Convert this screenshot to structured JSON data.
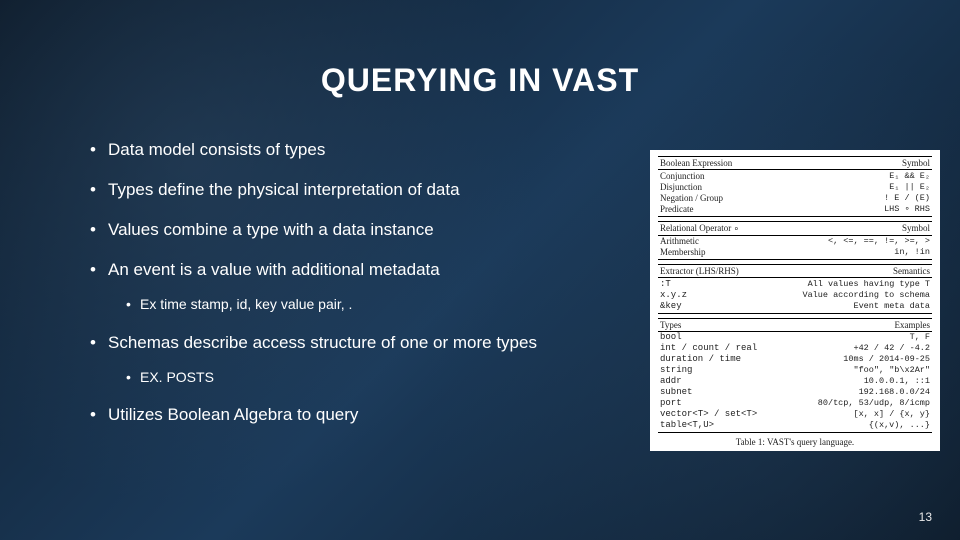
{
  "title": "QUERYING IN VAST",
  "bullets": {
    "b1": "Data model consists of types",
    "b2": "Types define the physical interpretation of data",
    "b3": "Values combine a type with a data instance",
    "b4": "An event is a value with additional metadata",
    "b4s1": "Ex time stamp, id, key value pair, .",
    "b5": "Schemas describe access structure of one or more types",
    "b5s1": "EX. POSTS",
    "b6": "Utilizes Boolean Algebra to query"
  },
  "table": {
    "sec1": {
      "h1": "Boolean Expression",
      "h2": "Symbol",
      "r1a": "Conjunction",
      "r1b": "E₁ && E₂",
      "r2a": "Disjunction",
      "r2b": "E₁ || E₂",
      "r3a": "Negation / Group",
      "r3b": "! E / (E)",
      "r4a": "Predicate",
      "r4b": "LHS ∘ RHS"
    },
    "sec2": {
      "h1": "Relational Operator ∘",
      "h2": "Symbol",
      "r1a": "Arithmetic",
      "r1b": "<, <=, ==, !=, >=, >",
      "r2a": "Membership",
      "r2b": "in, !in"
    },
    "sec3": {
      "h1": "Extractor (LHS/RHS)",
      "h2": "Semantics",
      "r1a": ":T",
      "r1b": "All values having type T",
      "r2a": "x.y.z",
      "r2b": "Value according to schema",
      "r3a": "&key",
      "r3b": "Event meta data"
    },
    "sec4": {
      "h1": "Types",
      "h2": "Examples",
      "r1a": "bool",
      "r1b": "T, F",
      "r2a": "int / count / real",
      "r2b": "+42 / 42 / -4.2",
      "r3a": "duration / time",
      "r3b": "10ms / 2014-09-25",
      "r4a": "string",
      "r4b": "\"foo\", \"b\\x2Ar\"",
      "r5a": "addr",
      "r5b": "10.0.0.1, ::1",
      "r6a": "subnet",
      "r6b": "192.168.0.0/24",
      "r7a": "port",
      "r7b": "80/tcp, 53/udp, 8/icmp",
      "r8a": "vector<T> / set<T>",
      "r8b": "[x, x] / {x, y}",
      "r9a": "table<T,U>",
      "r9b": "{(x,v), ...}"
    },
    "caption": "Table 1: VAST's query language."
  },
  "page_number": "13"
}
